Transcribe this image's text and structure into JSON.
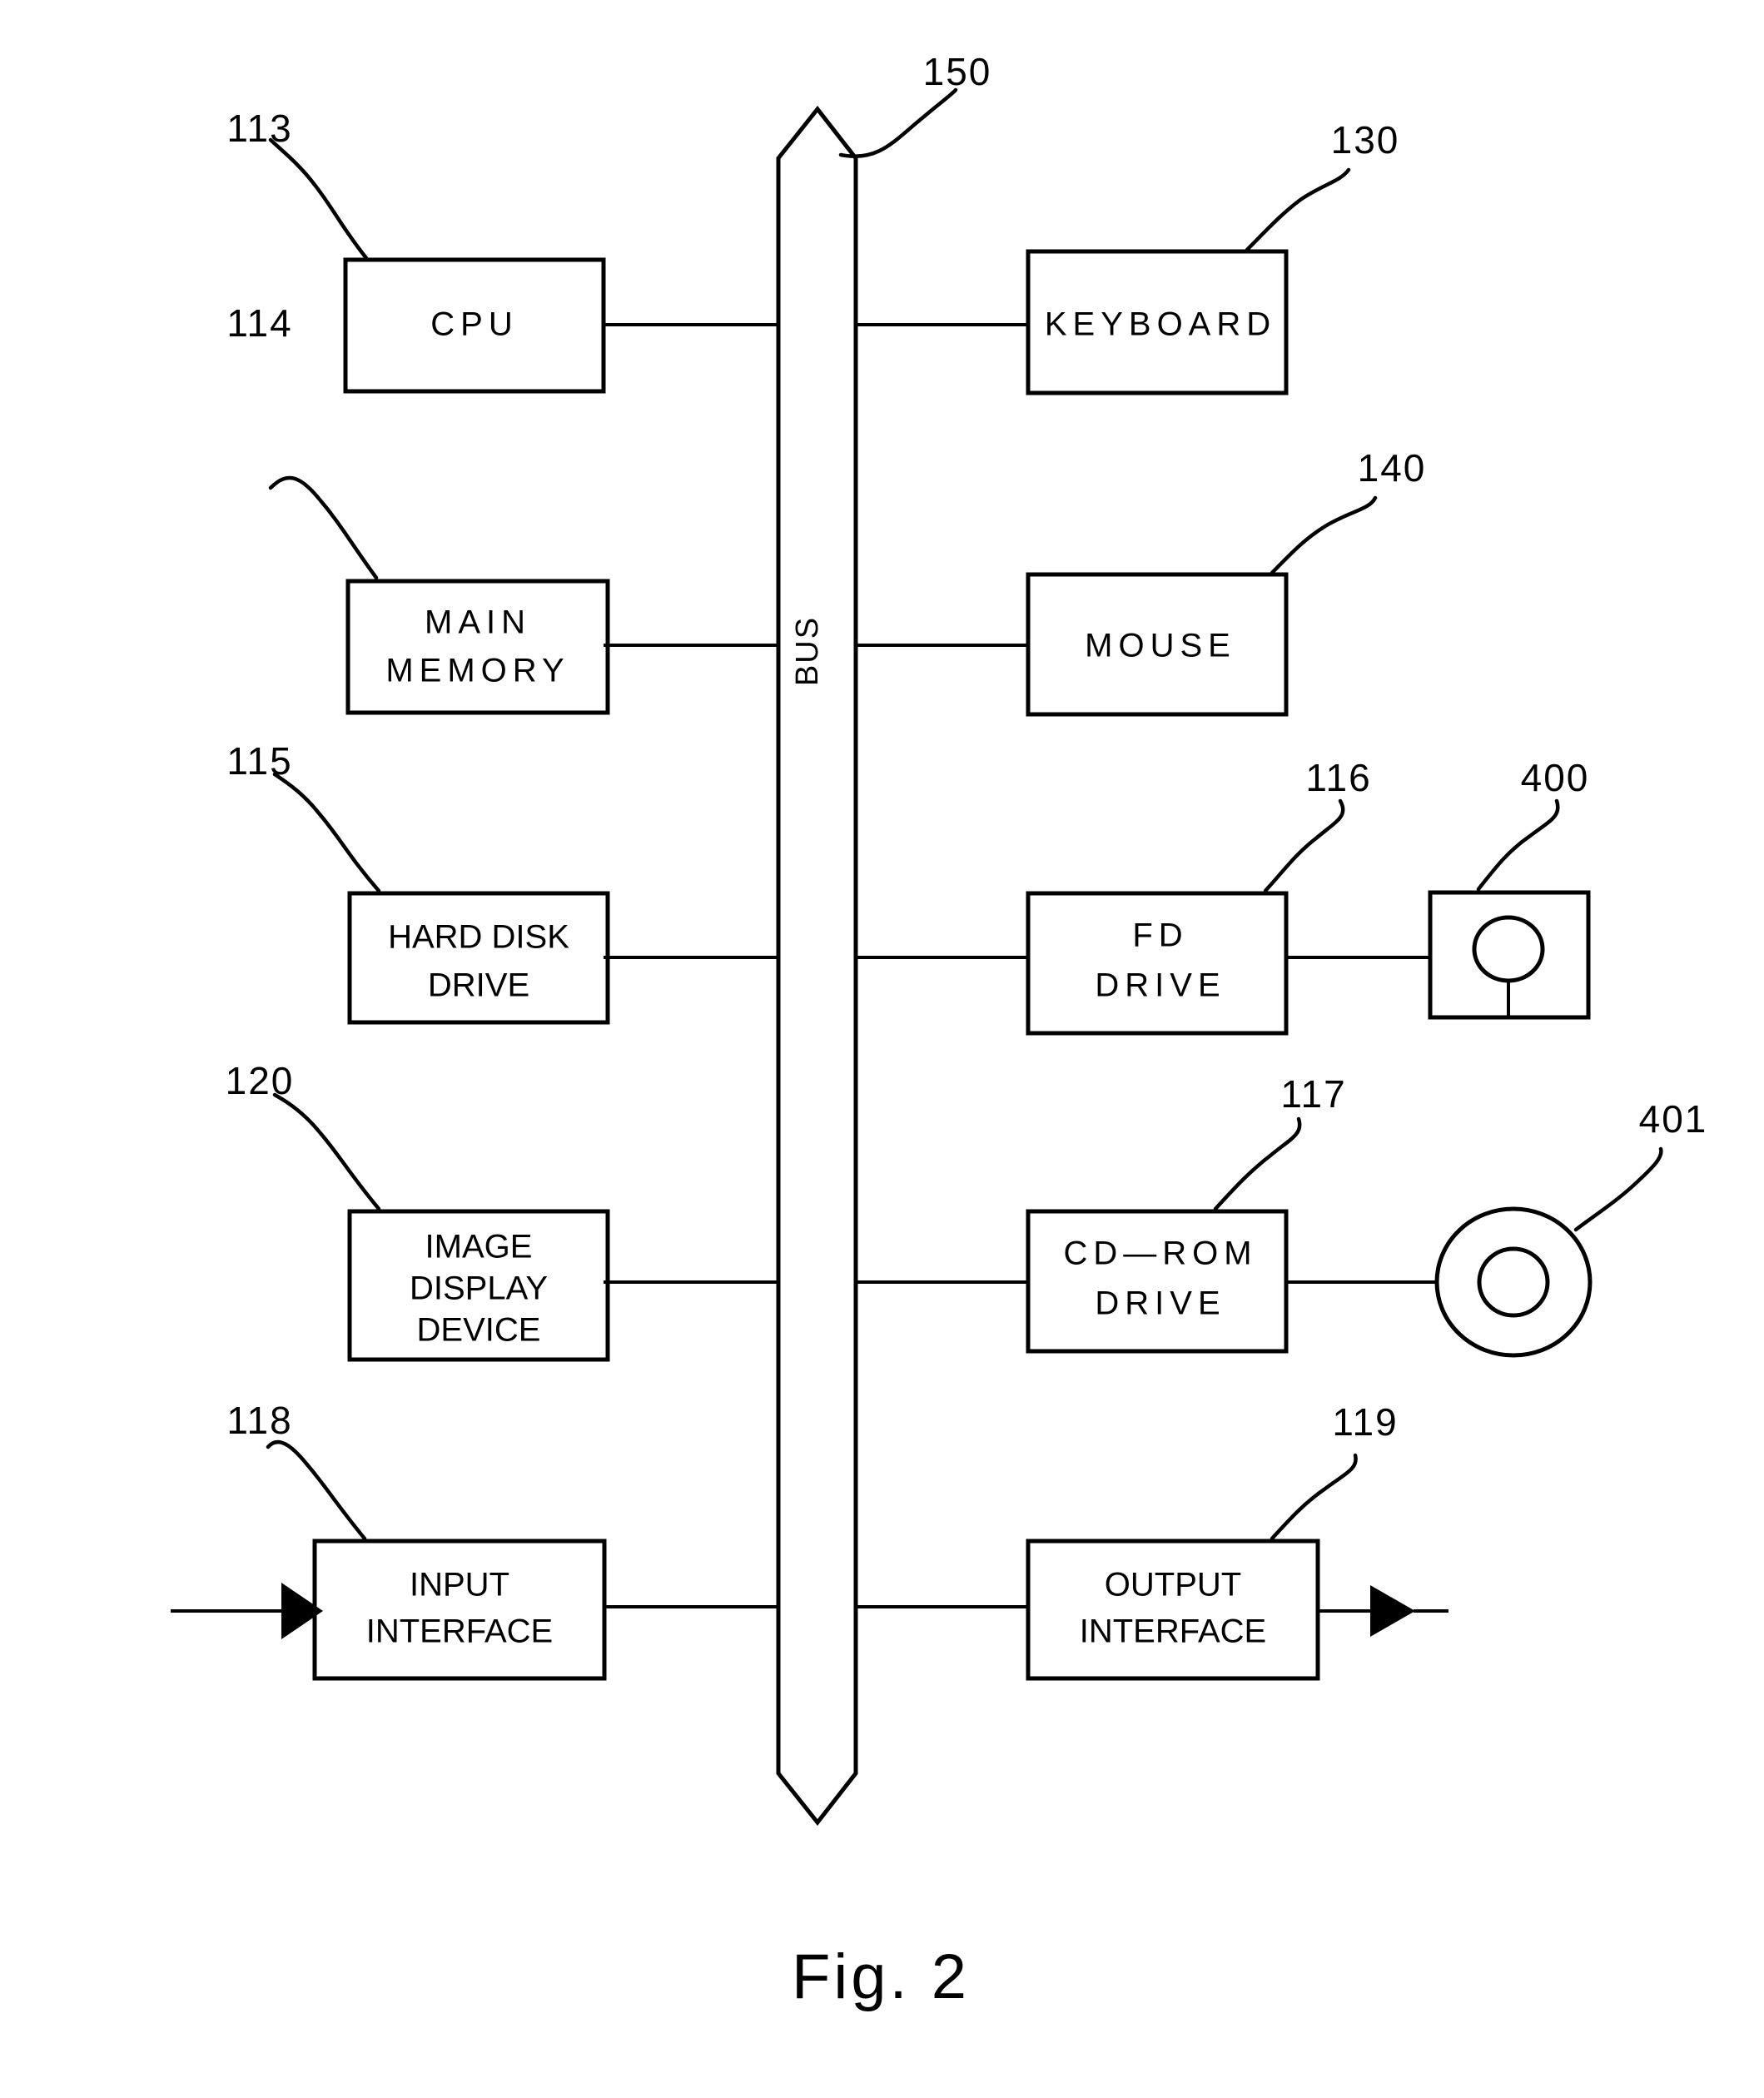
{
  "figure": {
    "caption": "Fig.  2",
    "bus": {
      "label": "BUS",
      "ref": "150"
    },
    "left_blocks": [
      {
        "id": "cpu",
        "label_lines": [
          "CPU"
        ],
        "ref": "113",
        "style": "wide"
      },
      {
        "id": "main-memory",
        "label_lines": [
          "MAIN",
          "MEMORY"
        ],
        "ref": "114",
        "style": "wide"
      },
      {
        "id": "hard-disk",
        "label_lines": [
          "HARD DISK",
          "DRIVE"
        ],
        "ref": "115",
        "style": "narrow"
      },
      {
        "id": "image-display",
        "label_lines": [
          "IMAGE",
          "DISPLAY",
          "DEVICE"
        ],
        "ref": "120",
        "style": "narrow"
      },
      {
        "id": "input-iface",
        "label_lines": [
          "INPUT",
          "INTERFACE"
        ],
        "ref": "118",
        "style": "narrow"
      }
    ],
    "right_blocks": [
      {
        "id": "keyboard",
        "label_lines": [
          "KEYBOARD"
        ],
        "ref": "130",
        "style": "wide"
      },
      {
        "id": "mouse",
        "label_lines": [
          "MOUSE"
        ],
        "ref": "140",
        "style": "wide"
      },
      {
        "id": "fd-drive",
        "label_lines": [
          "FD",
          "DRIVE"
        ],
        "ref": "116",
        "style": "wide"
      },
      {
        "id": "cdrom-drive",
        "label_lines": [
          "CD—ROM",
          "DRIVE"
        ],
        "ref": "117",
        "style": "wide"
      },
      {
        "id": "output-iface",
        "label_lines": [
          "OUTPUT",
          "INTERFACE"
        ],
        "ref": "119",
        "style": "narrow"
      }
    ],
    "media": [
      {
        "id": "floppy-disk",
        "ref": "400",
        "shape": "square-with-circle"
      },
      {
        "id": "cd-disc",
        "ref": "401",
        "shape": "concentric-circles"
      }
    ],
    "arrows": [
      {
        "id": "input-signal-arrow",
        "direction": "right",
        "target": "input-iface"
      },
      {
        "id": "output-signal-arrow",
        "direction": "right",
        "source": "output-iface"
      }
    ],
    "colors": {
      "ink": "#000000",
      "paper": "#ffffff"
    }
  }
}
